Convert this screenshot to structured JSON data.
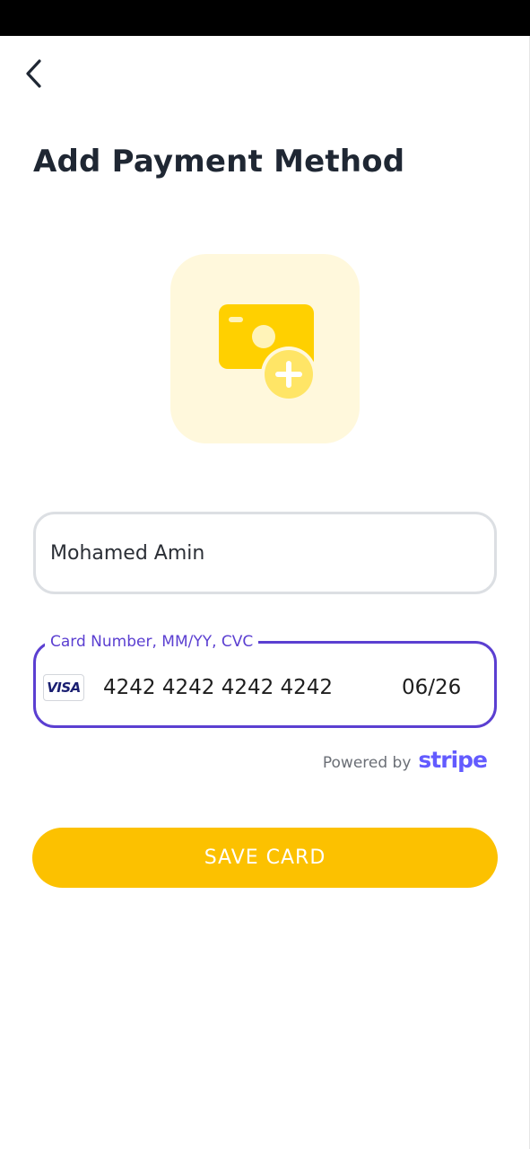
{
  "header": {
    "back_icon": "chevron-left-icon",
    "title": "Add Payment Method"
  },
  "illustration": {
    "icon": "add-card-icon",
    "background_color": "#fff8dc",
    "accent_color": "#ffd000"
  },
  "form": {
    "name_value": "Mohamed Amin",
    "card_field_label": "Card Number, MM/YY, CVC",
    "card_brand": "VISA",
    "card_number": "4242 4242 4242 4242",
    "card_expiry": "06/26",
    "focus_color": "#5b3fd1"
  },
  "powered_by": {
    "text": "Powered by",
    "brand": "stripe",
    "brand_color": "#635bff"
  },
  "actions": {
    "save_label": "SAVE CARD",
    "save_color": "#fcc100"
  }
}
